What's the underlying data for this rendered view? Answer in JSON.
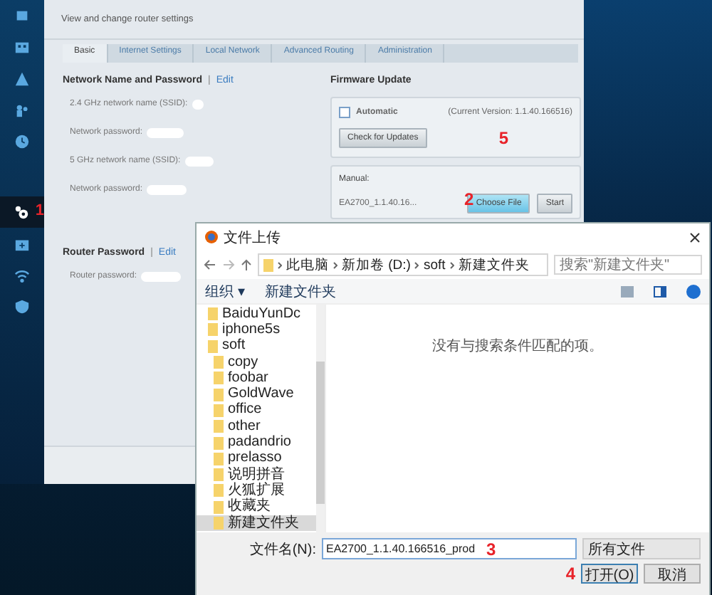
{
  "sidebar": {
    "items": [
      {
        "selected": false
      },
      {
        "selected": false
      },
      {
        "selected": false
      },
      {
        "selected": false
      },
      {
        "selected": false
      },
      {
        "selected": true
      },
      {
        "selected": false
      },
      {
        "selected": false
      },
      {
        "selected": false
      }
    ],
    "annotation": "1"
  },
  "header": {
    "subtitle": "View and change router settings"
  },
  "tabs": [
    {
      "label": "Basic",
      "selected": true
    },
    {
      "label": "Internet Settings",
      "selected": false
    },
    {
      "label": "Local Network",
      "selected": false
    },
    {
      "label": "Advanced Routing",
      "selected": false
    },
    {
      "label": "Administration",
      "selected": false
    }
  ],
  "network_section": {
    "title": "Network Name and Password",
    "separator": "|",
    "edit": "Edit",
    "fields": [
      {
        "label": "2.4 GHz network name (SSID):"
      },
      {
        "label": "Network password:"
      },
      {
        "label": "5 GHz network name (SSID):"
      },
      {
        "label": "Network password:"
      }
    ]
  },
  "router_password": {
    "title": "Router Password",
    "separator": "|",
    "edit": "Edit",
    "fields": [
      {
        "label": "Router password:"
      }
    ]
  },
  "firmware": {
    "title": "Firmware Update",
    "automatic": {
      "label": "Automatic",
      "checked": false
    },
    "current_version": "(Current Version: 1.1.40.166516)",
    "check_button": "Check for Updates",
    "annotation": "5",
    "manual": {
      "label": "Manual:",
      "file": "EA2700_1.1.40.16...",
      "choose_button": "Choose File",
      "start_button": "Start",
      "annotation": "2"
    }
  },
  "dialog": {
    "title": "文件上传",
    "path": [
      "此电脑",
      "新加卷 (D:)",
      "soft",
      "新建文件夹"
    ],
    "search": {
      "placeholder": "搜索\"新建文件夹\""
    },
    "toolbar": {
      "organize": "组织 ▾",
      "new_folder": "新建文件夹"
    },
    "nav": [
      {
        "label": "BaiduYunDc",
        "selected": false
      },
      {
        "label": "iphone5s",
        "selected": false
      },
      {
        "label": "soft",
        "selected": false,
        "children": [
          {
            "label": "copy",
            "selected": false
          },
          {
            "label": "foobar",
            "selected": false
          },
          {
            "label": "GoldWave",
            "selected": false
          },
          {
            "label": "office",
            "selected": false
          },
          {
            "label": "other",
            "selected": false
          },
          {
            "label": "padandrio",
            "selected": false
          },
          {
            "label": "prelasso",
            "selected": false
          },
          {
            "label": "说明拼音",
            "selected": false
          },
          {
            "label": "火狐扩展",
            "selected": false
          },
          {
            "label": "收藏夹",
            "selected": false
          },
          {
            "label": "新建文件夹",
            "selected": true
          }
        ]
      }
    ],
    "empty_message": "没有与搜索条件匹配的项。",
    "filename_label": "文件名(N):",
    "filename": "EA2700_1.1.40.166516_prod",
    "filename_annotation": "3",
    "filetype": "所有文件",
    "open_button": "打开(O)",
    "open_annotation": "4",
    "cancel_button": "取消"
  }
}
